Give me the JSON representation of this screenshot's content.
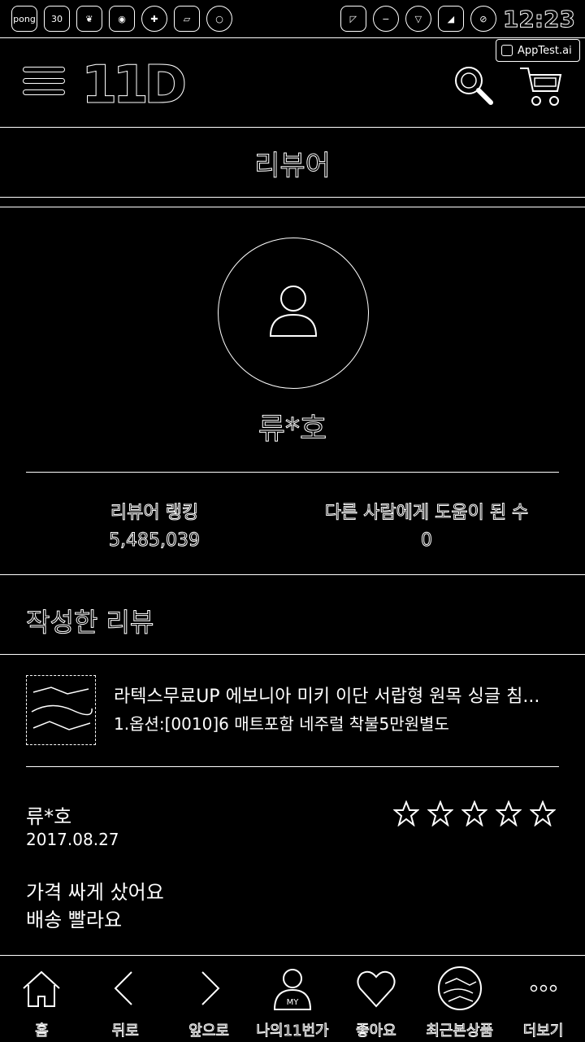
{
  "status_bar": {
    "left_icons": [
      "pong-icon",
      "notification-icon",
      "leaf-icon",
      "game-icon",
      "clock-icon",
      "folder-icon",
      "record-icon"
    ],
    "right_icons": [
      "cast-icon",
      "minus-icon",
      "wifi-icon",
      "signal-icon",
      "battery-icon"
    ],
    "pong_label": "pong",
    "notification_label": "30",
    "time": "12:23"
  },
  "badge": {
    "label": "AppTest.ai"
  },
  "header": {
    "logo": "11D"
  },
  "page": {
    "title": "리뷰어"
  },
  "profile": {
    "name": "류*호",
    "stats": [
      {
        "label": "리뷰어 랭킹",
        "value": "5,485,039"
      },
      {
        "label": "다른 사람에게 도움이 된 수",
        "value": "0"
      }
    ]
  },
  "reviews_section": {
    "title": "작성한 리뷰"
  },
  "review": {
    "product_title": "라텍스무료UP 에보니아 미키 이단 서랍형 원목 싱글 침...",
    "product_option": "1.옵션:[0010]6 매트포함 네주럴 착불5만원별도",
    "reviewer": "류*호",
    "date": "2017.08.27",
    "rating": 5,
    "body_lines": [
      "가격 싸게 샀어요",
      "배송 빨라요"
    ]
  },
  "bottom_nav": {
    "items": [
      {
        "label": "홈",
        "icon": "home-icon"
      },
      {
        "label": "뒤로",
        "icon": "back-icon"
      },
      {
        "label": "앞으로",
        "icon": "forward-icon"
      },
      {
        "label": "나의11번가",
        "icon": "my-icon"
      },
      {
        "label": "좋아요",
        "icon": "heart-icon"
      },
      {
        "label": "최근본상품",
        "icon": "recent-product-icon"
      },
      {
        "label": "더보기",
        "icon": "more-icon"
      }
    ],
    "my_badge": "MY"
  }
}
